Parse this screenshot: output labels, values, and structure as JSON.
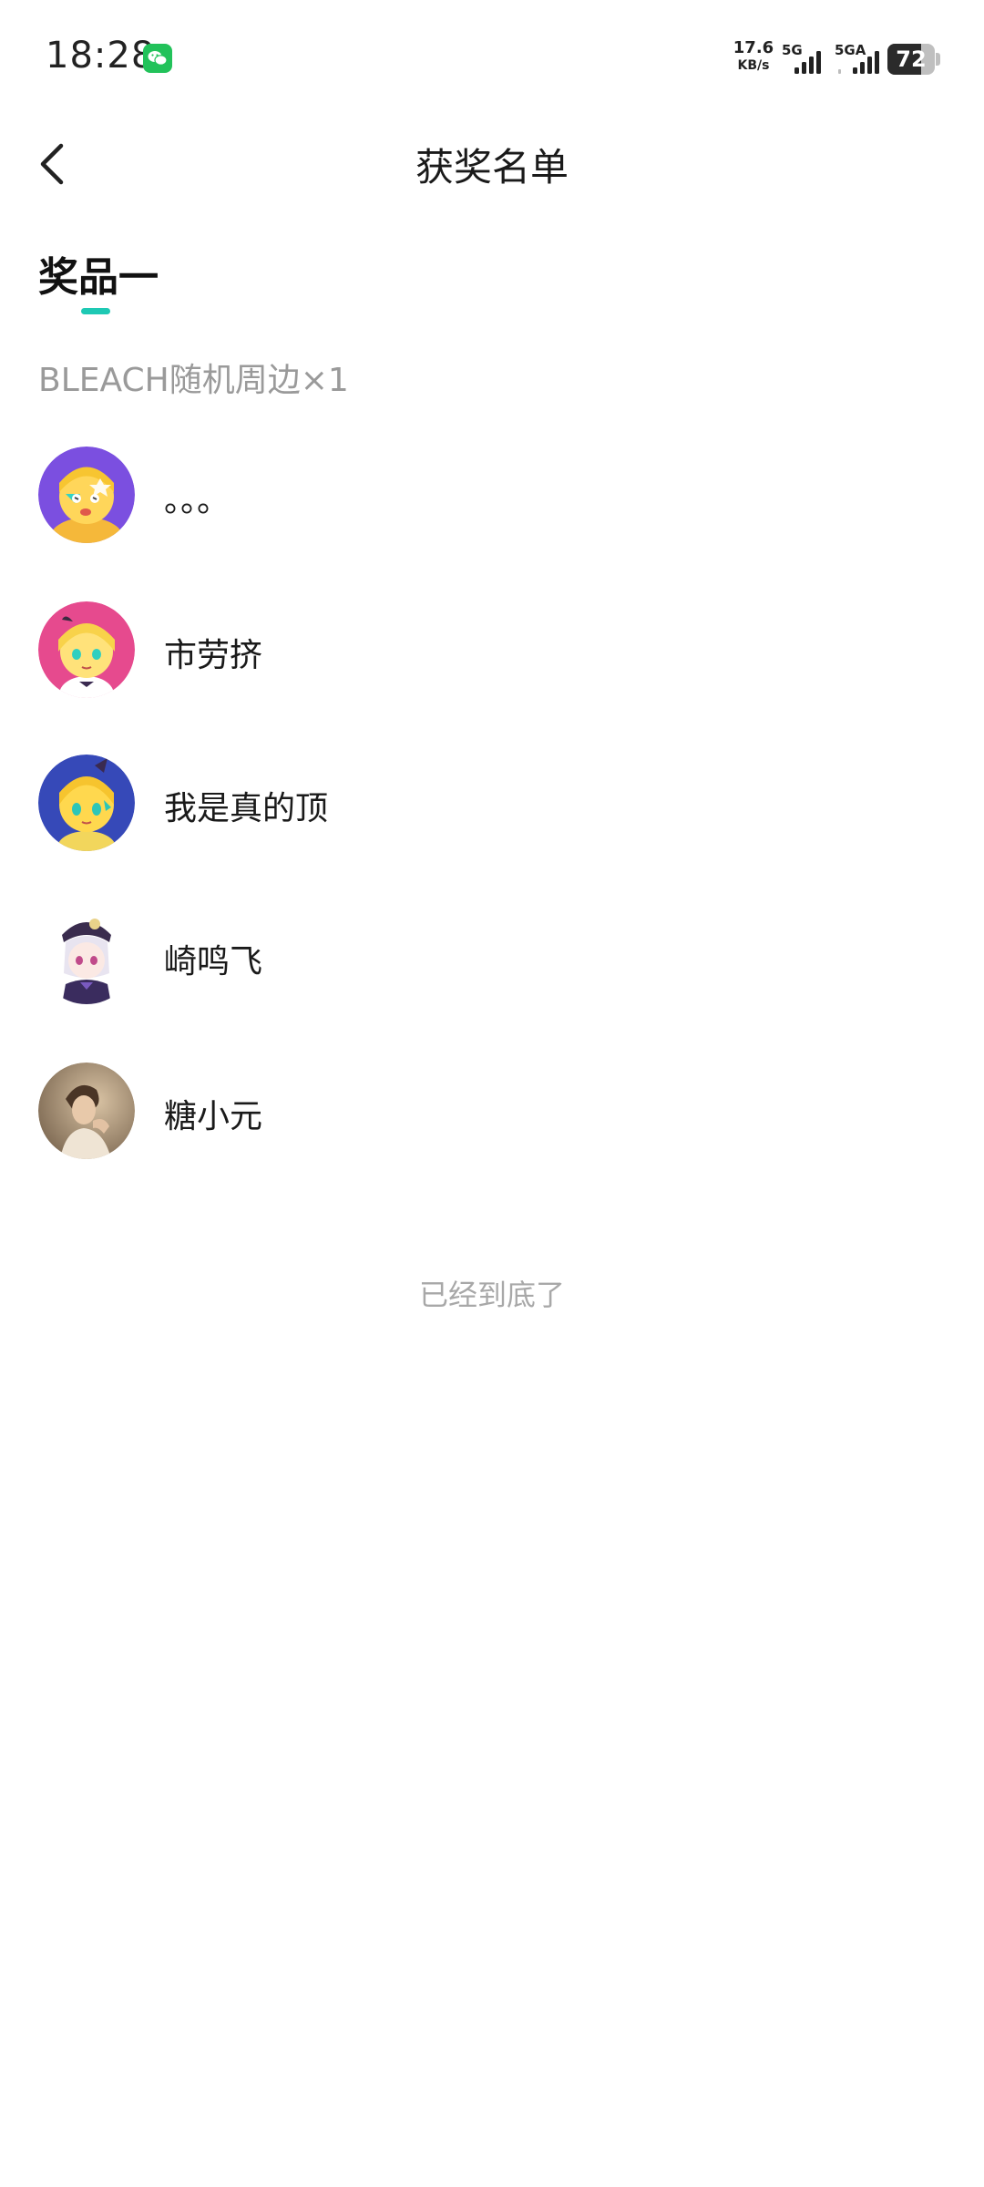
{
  "status_bar": {
    "time": "18:28",
    "net_speed_value": "17.6",
    "net_speed_unit": "KB/s",
    "signal_1_label": "5G",
    "signal_2_label": "5GA",
    "battery_level": "72",
    "notification_icon": "wechat-icon"
  },
  "header": {
    "title": "获奖名单",
    "back_icon": "chevron-left-icon"
  },
  "prize": {
    "tab_label": "奖品一",
    "description": "BLEACH随机周边×1",
    "accent_color": "#1ec9b4"
  },
  "winners": [
    {
      "name": "。。。",
      "avatar": "anime-girl-avatar-purple"
    },
    {
      "name": "市劳挤",
      "avatar": "anime-girl-avatar-pink"
    },
    {
      "name": "我是真的顶",
      "avatar": "anime-girl-avatar-blue"
    },
    {
      "name": "崎鸣飞",
      "avatar": "anime-character-avatar-white"
    },
    {
      "name": "糖小元",
      "avatar": "photo-avatar-person"
    }
  ],
  "list_end_text": "已经到底了"
}
